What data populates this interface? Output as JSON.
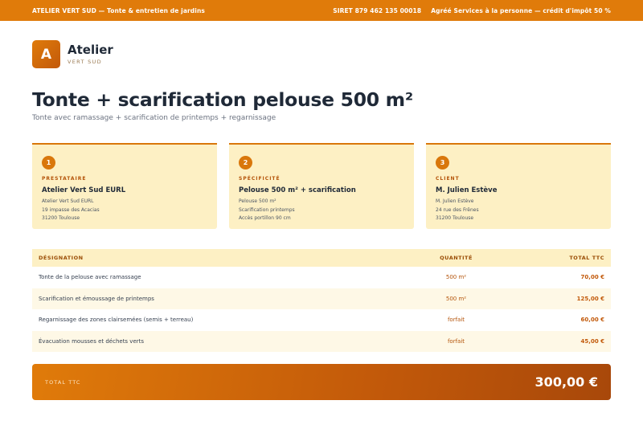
{
  "topbar": {
    "left": "ATELIER VERT SUD — Tonte & entretien de jardins",
    "siret": "SIRET 879 462 135 00018",
    "agrement": "Agréé Services à la personne — crédit d'impôt 50 %"
  },
  "brand": {
    "initial": "A",
    "name": "Atelier",
    "sub": "VERT SUD"
  },
  "title": "Tonte + scarification pelouse 500 m²",
  "subtitle": "Tonte avec ramassage + scarification de printemps + regarnissage",
  "cards": [
    {
      "num": "1",
      "label": "PRESTATAIRE",
      "title": "Atelier Vert Sud EURL",
      "lines": [
        "Atelier Vert Sud EURL",
        "19 impasse des Acacias",
        "31200 Toulouse"
      ]
    },
    {
      "num": "2",
      "label": "SPÉCIFICITÉ",
      "title": "Pelouse 500 m² + scarification",
      "lines": [
        "Pelouse 500 m²",
        "Scarification printemps",
        "Accès portillon 90 cm"
      ]
    },
    {
      "num": "3",
      "label": "CLIENT",
      "title": "M. Julien Estève",
      "lines": [
        "M. Julien Estève",
        "24 rue des Frênes",
        "31200 Toulouse"
      ]
    }
  ],
  "table": {
    "headers": [
      "DÉSIGNATION",
      "QUANTITÉ",
      "TOTAL TTC"
    ],
    "rows": [
      {
        "designation": "Tonte de la pelouse avec ramassage",
        "quantite": "500 m²",
        "total": "70,00 €"
      },
      {
        "designation": "Scarification et émoussage de printemps",
        "quantite": "500 m²",
        "total": "125,00 €"
      },
      {
        "designation": "Regarnissage des zones clairsemées (semis + terreau)",
        "quantite": "forfait",
        "total": "60,00 €"
      },
      {
        "designation": "Évacuation mousses et déchets verts",
        "quantite": "forfait",
        "total": "45,00 €"
      }
    ]
  },
  "total": {
    "label": "TOTAL TTC",
    "value": "300,00 €"
  },
  "colors": {
    "accent": "#e07b0a",
    "accent_dark": "#c2590a",
    "card_bg": "#fdf0c4"
  }
}
